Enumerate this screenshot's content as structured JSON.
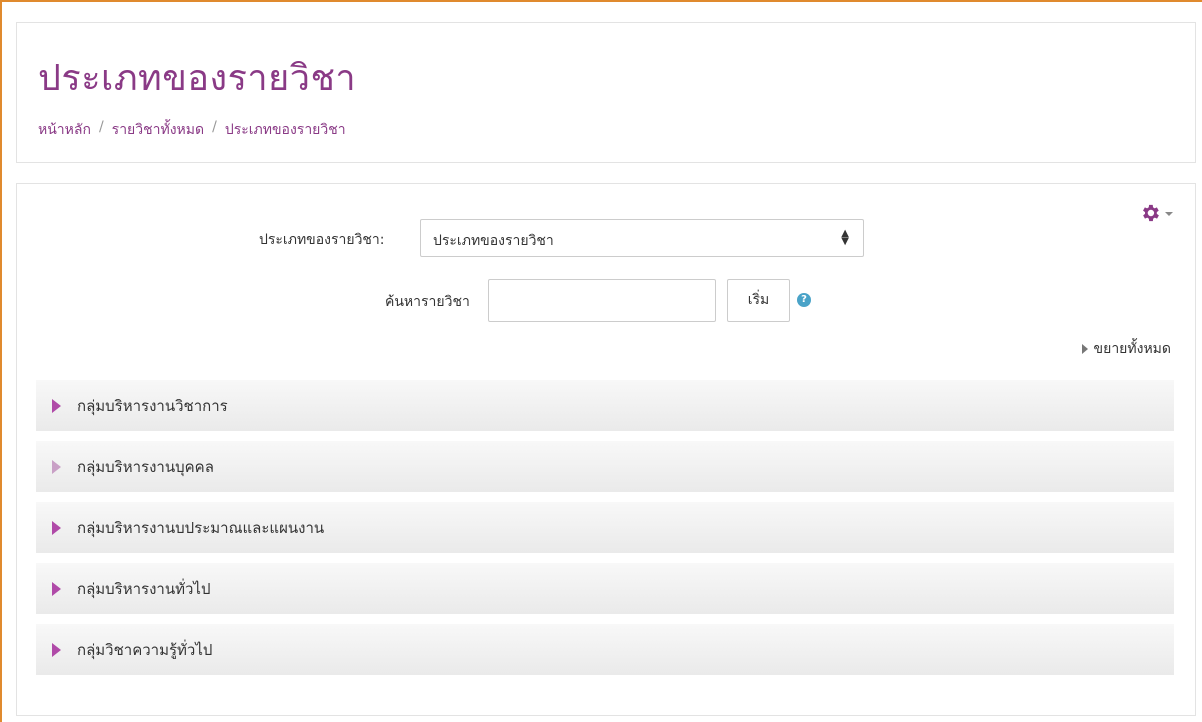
{
  "header": {
    "title": "ประเภทของรายวิชา",
    "breadcrumb": [
      "หน้าหลัก",
      "รายวิชาทั้งหมด",
      "ประเภทของรายวิชา"
    ],
    "separator": "/"
  },
  "filters": {
    "category_label": "ประเภทของรายวิชา:",
    "category_selected": "ประเภทของรายวิชา",
    "search_label": "ค้นหารายวิชา",
    "search_value": "",
    "go_button": "เริ่ม",
    "help_icon": "?"
  },
  "expand_all": "ขยายทั้งหมด",
  "categories": [
    {
      "label": "กลุ่มบริหารงานวิชาการ",
      "icon": "expand-triangle-icon"
    },
    {
      "label": "กลุ่มบริหารงานบุคคล",
      "icon": "expand-triangle-outline-icon"
    },
    {
      "label": "กลุ่มบริหารงานบประมาณและแผนงาน",
      "icon": "expand-triangle-icon"
    },
    {
      "label": "กลุ่มบริหารงานทั่วไป",
      "icon": "expand-triangle-icon"
    },
    {
      "label": "กลุ่มวิชาความรู้ทั่วไป",
      "icon": "expand-triangle-icon"
    }
  ],
  "colors": {
    "accent": "#8a3a86",
    "triangle": "#b04aa8",
    "help": "#4aa3c8",
    "frame": "#e08a2e"
  }
}
